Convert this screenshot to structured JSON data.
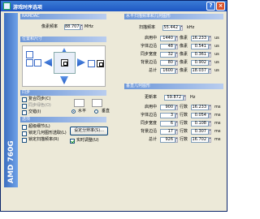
{
  "window": {
    "title": "游戏时序选项",
    "help_label": "?",
    "close_label": "×"
  },
  "sidebar": {
    "brand": "AMD 760G"
  },
  "ramdac": {
    "header": "RAMDAC",
    "pixel_clock_label": "像素频率",
    "pixel_clock_value": "88.707",
    "pixel_clock_unit": "MHz"
  },
  "position": {
    "header": "位置和尺寸"
  },
  "sync": {
    "header": "同步",
    "composite_sync": {
      "label": "复合同步(C)",
      "checked": false
    },
    "sync_on_green": {
      "label": "同步绿色(O)",
      "checked": false
    },
    "interlaced": {
      "label": "交错(I)",
      "checked": false
    },
    "horizontal_label": "水平",
    "vertical_label": "垂直"
  },
  "options": {
    "header": "选项",
    "advanced_mode": {
      "label": "超级细节(L)",
      "checked": false
    },
    "lock_aspect": {
      "label": "锁定几何图形选取(L)",
      "checked": false
    },
    "lock_refresh": {
      "label": "锁定扫描频率(R)",
      "checked": false
    },
    "set_resolution_button": "设定分辨率(S)...",
    "realtime_update": {
      "label": "实时调整(U)",
      "checked": true
    }
  },
  "horizontal": {
    "header": "水平扫描频率和几何图形",
    "scan_label": "扫描频率",
    "scan_value": "55.442",
    "scan_unit": "kHz",
    "rows": [
      {
        "label": "启用中",
        "pixels": "1440",
        "unit1": "像素",
        "time": "16.233",
        "unit2": "us"
      },
      {
        "label": "字体边沿",
        "pixels": "48",
        "unit1": "像素",
        "time": "0.541",
        "unit2": "us"
      },
      {
        "label": "同步宽度",
        "pixels": "32",
        "unit1": "像素",
        "time": "0.361",
        "unit2": "us"
      },
      {
        "label": "背景边沿",
        "pixels": "80",
        "unit1": "像素",
        "time": "0.902",
        "unit2": "us"
      },
      {
        "label": "总计",
        "pixels": "1600",
        "unit1": "像素",
        "time": "18.037",
        "unit2": "us"
      }
    ]
  },
  "vertical": {
    "header": "垂直几何图形",
    "refresh_label": "更新率",
    "refresh_value": "59.872",
    "refresh_unit": "Hz",
    "rows": [
      {
        "label": "启用中",
        "lines": "900",
        "unit1": "行数",
        "time": "16.233",
        "unit2": "ms"
      },
      {
        "label": "字体边沿",
        "lines": "3",
        "unit1": "行数",
        "time": "0.054",
        "unit2": "ms"
      },
      {
        "label": "同步宽度",
        "lines": "6",
        "unit1": "行数",
        "time": "0.108",
        "unit2": "ms"
      },
      {
        "label": "背景边沿",
        "lines": "17",
        "unit1": "行数",
        "time": "0.307",
        "unit2": "ms"
      },
      {
        "label": "总计",
        "lines": "926",
        "unit1": "行数",
        "time": "16.702",
        "unit2": "ms"
      }
    ]
  }
}
